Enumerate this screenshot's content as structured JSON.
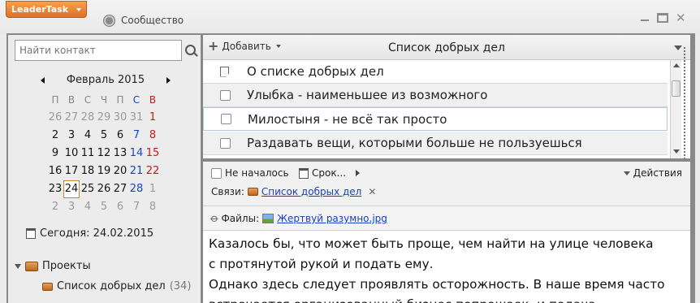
{
  "titlebar": {
    "app_menu_label": "LeaderTask",
    "community_label": "Сообщество"
  },
  "left_panel": {
    "search_placeholder": "Найти контакт",
    "calendar": {
      "month_label": "Февраль 2015",
      "weekdays": [
        "П",
        "В",
        "С",
        "Ч",
        "П",
        "С",
        "В"
      ],
      "weeks": [
        [
          "26",
          "27",
          "28",
          "29",
          "30",
          "31",
          "1"
        ],
        [
          "2",
          "3",
          "4",
          "5",
          "6",
          "7",
          "8"
        ],
        [
          "9",
          "10",
          "11",
          "12",
          "13",
          "14",
          "15"
        ],
        [
          "16",
          "17",
          "18",
          "19",
          "20",
          "21",
          "22"
        ],
        [
          "23",
          "24",
          "25",
          "26",
          "27",
          "28",
          "1"
        ],
        [
          "2",
          "3",
          "4",
          "5",
          "6",
          "7",
          "8"
        ]
      ],
      "selected_day": "24"
    },
    "today_label": "Сегодня: 24.02.2015",
    "projects_label": "Проекты",
    "project_item": {
      "name": "Список добрых дел",
      "count": "(34)"
    }
  },
  "tasks": {
    "add_label": "Добавить",
    "list_title": "Список добрых дел",
    "items": [
      {
        "text": "О списке добрых дел",
        "type": "note"
      },
      {
        "text": "Улыбка - наименьшее из возможного",
        "type": "task"
      },
      {
        "text": "Милостыня - не всё так просто",
        "type": "task",
        "selected": true
      },
      {
        "text": "Раздавать вещи, которыми больше не пользуешься",
        "type": "task"
      }
    ]
  },
  "detail": {
    "status_label": "Не началось",
    "deadline_label": "Срок...",
    "actions_label": "Действия",
    "links_label": "Связи:",
    "link_name": "Список добрых дел",
    "files_label": "Файлы:",
    "file_name": "Жертвуй разумно.jpg",
    "body_lines": [
      "Казалось бы, что может быть проще, чем найти на улице человека",
      "с протянутой рукой и подать ему.",
      "Однако здесь следует проявлять осторожность. В наше время часто",
      "встречается организованный бизнес попрошаек, и подача"
    ]
  },
  "colors": {
    "accent_orange": "#e0702a",
    "link_blue": "#1a3fc8",
    "weekend_blue": "#1a44c8",
    "weekend_red": "#c41a1a"
  }
}
